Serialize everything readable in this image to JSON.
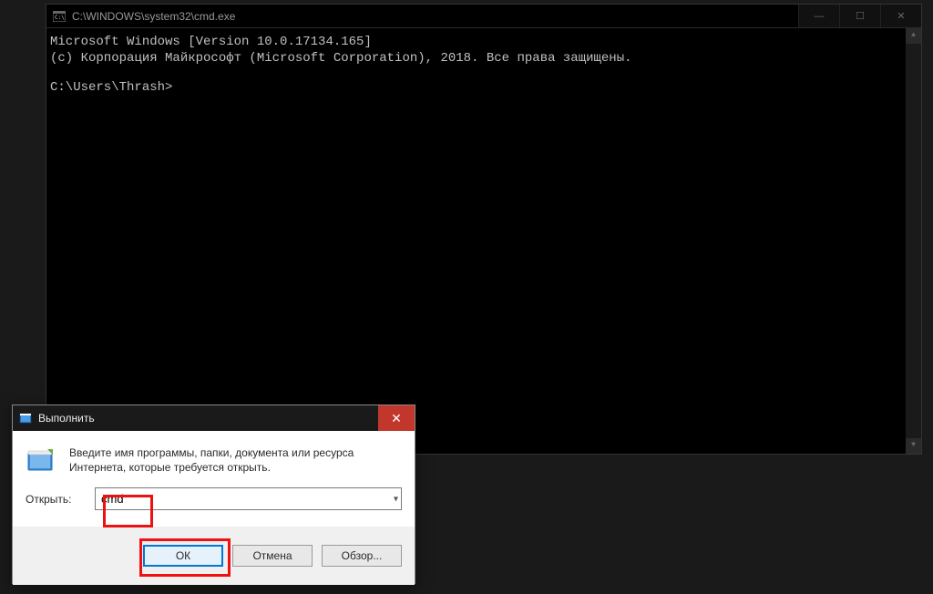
{
  "cmd": {
    "title": "C:\\WINDOWS\\system32\\cmd.exe",
    "line1": "Microsoft Windows [Version 10.0.17134.165]",
    "line2": "(с) Корпорация Майкрософт (Microsoft Corporation), 2018. Все права защищены.",
    "prompt": "C:\\Users\\Thrash>"
  },
  "run": {
    "title": "Выполнить",
    "description": "Введите имя программы, папки, документа или ресурса Интернета, которые требуется открыть.",
    "label": "Открыть:",
    "input_value": "cmd",
    "buttons": {
      "ok": "ОК",
      "cancel": "Отмена",
      "browse": "Обзор..."
    }
  },
  "icons": {
    "cmd_window": "cmd-icon",
    "run_window": "run-icon",
    "run_app": "run-app-icon"
  },
  "window_controls": {
    "minimize": "—",
    "maximize": "☐",
    "close": "✕"
  }
}
